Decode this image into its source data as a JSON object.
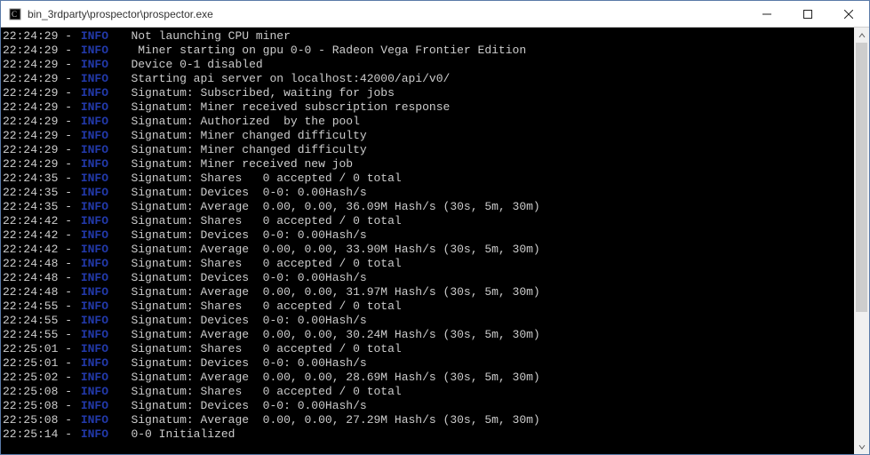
{
  "window": {
    "title": "bin_3rdparty\\prospector\\prospector.exe"
  },
  "log": [
    {
      "time": "22:24:29",
      "level": "INFO",
      "msg": " Not launching CPU miner"
    },
    {
      "time": "22:24:29",
      "level": "INFO",
      "msg": "  Miner starting on gpu 0-0 - Radeon Vega Frontier Edition"
    },
    {
      "time": "22:24:29",
      "level": "INFO",
      "msg": " Device 0-1 disabled"
    },
    {
      "time": "22:24:29",
      "level": "INFO",
      "msg": " Starting api server on localhost:42000/api/v0/"
    },
    {
      "time": "22:24:29",
      "level": "INFO",
      "msg": " Signatum: Subscribed, waiting for jobs"
    },
    {
      "time": "22:24:29",
      "level": "INFO",
      "msg": " Signatum: Miner received subscription response"
    },
    {
      "time": "22:24:29",
      "level": "INFO",
      "msg": " Signatum: Authorized  by the pool"
    },
    {
      "time": "22:24:29",
      "level": "INFO",
      "msg": " Signatum: Miner changed difficulty"
    },
    {
      "time": "22:24:29",
      "level": "INFO",
      "msg": " Signatum: Miner changed difficulty"
    },
    {
      "time": "22:24:29",
      "level": "INFO",
      "msg": " Signatum: Miner received new job"
    },
    {
      "time": "22:24:35",
      "level": "INFO",
      "msg": " Signatum: Shares   0 accepted / 0 total"
    },
    {
      "time": "22:24:35",
      "level": "INFO",
      "msg": " Signatum: Devices  0-0: 0.00Hash/s"
    },
    {
      "time": "22:24:35",
      "level": "INFO",
      "msg": " Signatum: Average  0.00, 0.00, 36.09M Hash/s (30s, 5m, 30m)"
    },
    {
      "time": "22:24:42",
      "level": "INFO",
      "msg": " Signatum: Shares   0 accepted / 0 total"
    },
    {
      "time": "22:24:42",
      "level": "INFO",
      "msg": " Signatum: Devices  0-0: 0.00Hash/s"
    },
    {
      "time": "22:24:42",
      "level": "INFO",
      "msg": " Signatum: Average  0.00, 0.00, 33.90M Hash/s (30s, 5m, 30m)"
    },
    {
      "time": "22:24:48",
      "level": "INFO",
      "msg": " Signatum: Shares   0 accepted / 0 total"
    },
    {
      "time": "22:24:48",
      "level": "INFO",
      "msg": " Signatum: Devices  0-0: 0.00Hash/s"
    },
    {
      "time": "22:24:48",
      "level": "INFO",
      "msg": " Signatum: Average  0.00, 0.00, 31.97M Hash/s (30s, 5m, 30m)"
    },
    {
      "time": "22:24:55",
      "level": "INFO",
      "msg": " Signatum: Shares   0 accepted / 0 total"
    },
    {
      "time": "22:24:55",
      "level": "INFO",
      "msg": " Signatum: Devices  0-0: 0.00Hash/s"
    },
    {
      "time": "22:24:55",
      "level": "INFO",
      "msg": " Signatum: Average  0.00, 0.00, 30.24M Hash/s (30s, 5m, 30m)"
    },
    {
      "time": "22:25:01",
      "level": "INFO",
      "msg": " Signatum: Shares   0 accepted / 0 total"
    },
    {
      "time": "22:25:01",
      "level": "INFO",
      "msg": " Signatum: Devices  0-0: 0.00Hash/s"
    },
    {
      "time": "22:25:02",
      "level": "INFO",
      "msg": " Signatum: Average  0.00, 0.00, 28.69M Hash/s (30s, 5m, 30m)"
    },
    {
      "time": "22:25:08",
      "level": "INFO",
      "msg": " Signatum: Shares   0 accepted / 0 total"
    },
    {
      "time": "22:25:08",
      "level": "INFO",
      "msg": " Signatum: Devices  0-0: 0.00Hash/s"
    },
    {
      "time": "22:25:08",
      "level": "INFO",
      "msg": " Signatum: Average  0.00, 0.00, 27.29M Hash/s (30s, 5m, 30m)"
    },
    {
      "time": "22:25:14",
      "level": "INFO",
      "msg": " 0-0 Initialized"
    }
  ]
}
